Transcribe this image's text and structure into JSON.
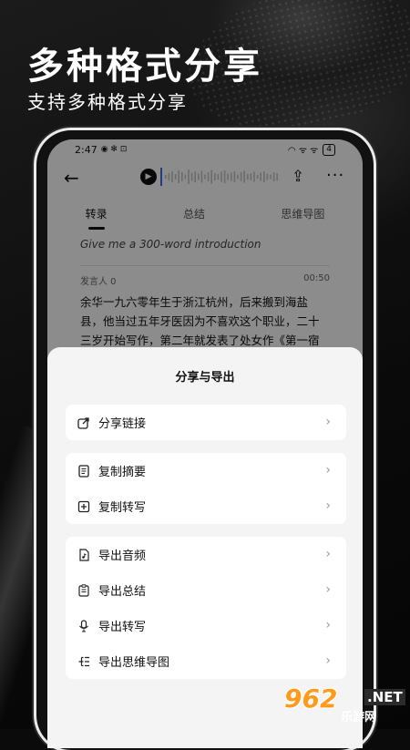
{
  "hero": {
    "title": "多种格式分享",
    "subtitle": "支持多种格式分享"
  },
  "status_bar": {
    "time": "2:47",
    "left_icons": "◉ ✻ ⊡",
    "right_icons": "◠ ᯤ ᯤ",
    "battery": "4"
  },
  "top_bar": {
    "back_icon": "arrow-left-icon",
    "play_icon": "play-icon",
    "share_icon": "share-icon",
    "more_icon": "more-icon"
  },
  "tabs": [
    {
      "label": "转录",
      "active": true
    },
    {
      "label": "总结",
      "active": false
    },
    {
      "label": "思维导图",
      "active": false
    }
  ],
  "query_text": "Give me a 300-word introduction",
  "speaker": {
    "name": "发言人 0",
    "time": "00:50"
  },
  "transcript": "余华一九六零年生于浙江杭州，后来搬到海盐县，他当过五年牙医因为不喜欢这个职业，二十三岁开始写作，第二年就发表了处女作《第一宿舍》。四年后，余华发表《西北风呼啸的中午》",
  "sheet": {
    "title": "分享与导出",
    "groups": [
      {
        "items": [
          {
            "label": "分享链接",
            "icon": "share-link-icon"
          }
        ]
      },
      {
        "items": [
          {
            "label": "复制摘要",
            "icon": "copy-summary-icon"
          },
          {
            "label": "复制转写",
            "icon": "copy-transcript-icon"
          }
        ]
      },
      {
        "items": [
          {
            "label": "导出音频",
            "icon": "export-audio-icon"
          },
          {
            "label": "导出总结",
            "icon": "export-summary-icon"
          },
          {
            "label": "导出转写",
            "icon": "export-transcript-icon"
          },
          {
            "label": "导出思维导图",
            "icon": "export-mindmap-icon"
          }
        ]
      }
    ]
  },
  "watermark": {
    "logo": "962",
    "net": ".NET",
    "sub": "乐游网"
  }
}
